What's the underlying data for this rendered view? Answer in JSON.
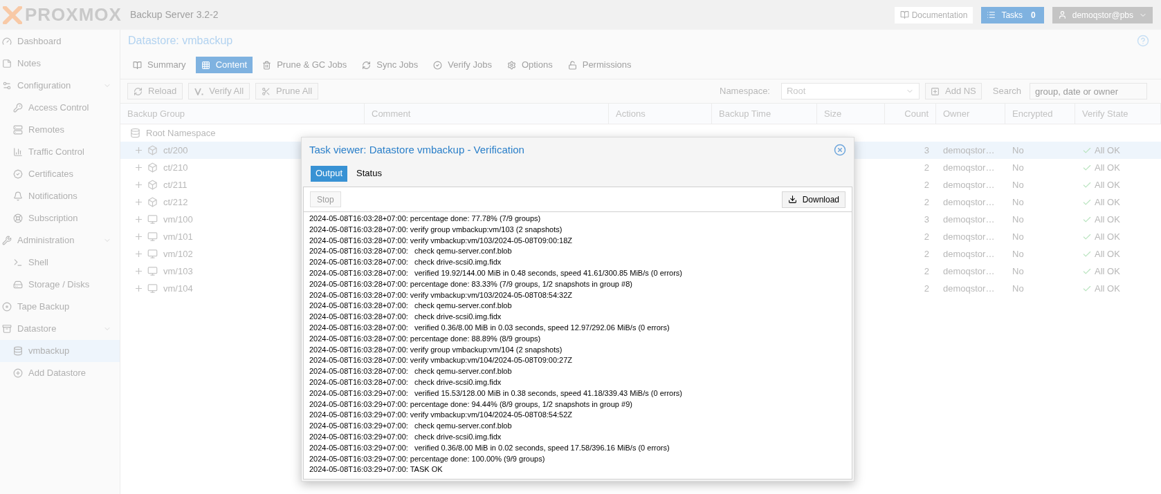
{
  "header": {
    "logo": "PROXMOX",
    "product": "Backup Server 3.2-2",
    "documentation": "Documentation",
    "tasks": {
      "label": "Tasks",
      "count": "0"
    },
    "user": "demoqstor@pbs"
  },
  "sidebar": {
    "items": [
      {
        "label": "Dashboard",
        "selected": false
      },
      {
        "label": "Notes",
        "selected": false
      },
      {
        "label": "Configuration",
        "selected": false,
        "children": [
          {
            "label": "Access Control",
            "selected": false
          },
          {
            "label": "Remotes",
            "selected": false
          },
          {
            "label": "Traffic Control",
            "selected": false
          },
          {
            "label": "Certificates",
            "selected": false
          },
          {
            "label": "Notifications",
            "selected": false
          },
          {
            "label": "Subscription",
            "selected": false
          }
        ]
      },
      {
        "label": "Administration",
        "selected": false,
        "children": [
          {
            "label": "Shell",
            "selected": false
          },
          {
            "label": "Storage / Disks",
            "selected": false
          }
        ]
      },
      {
        "label": "Tape Backup",
        "selected": false
      },
      {
        "label": "Datastore",
        "selected": false,
        "children": [
          {
            "label": "vmbackup",
            "selected": true
          },
          {
            "label": "Add Datastore",
            "selected": false
          }
        ]
      }
    ]
  },
  "content": {
    "title": "Datastore: vmbackup",
    "tabs": [
      {
        "label": "Summary",
        "selected": false
      },
      {
        "label": "Content",
        "selected": true
      },
      {
        "label": "Prune & GC Jobs",
        "selected": false
      },
      {
        "label": "Sync Jobs",
        "selected": false
      },
      {
        "label": "Verify Jobs",
        "selected": false
      },
      {
        "label": "Options",
        "selected": false
      },
      {
        "label": "Permissions",
        "selected": false
      }
    ],
    "toolbar": {
      "buttons": [
        "Reload",
        "Verify All",
        "Prune All"
      ],
      "namespace_label": "Namespace:",
      "namespace_value": "Root",
      "add_ns": "Add NS",
      "search_label": "Search",
      "search_placeholder": "group, date or owner"
    },
    "table": {
      "columns": [
        "Backup Group",
        "Comment",
        "Actions",
        "Backup Time",
        "Size",
        "Count",
        "Owner",
        "Encrypted",
        "Verify State"
      ],
      "root": "Root Namespace",
      "rows": [
        {
          "group": "ct/200",
          "kind": "container",
          "count": "3",
          "owner": "demoqstor…",
          "encrypted": "No",
          "verify": "All OK",
          "selected": true
        },
        {
          "group": "ct/210",
          "kind": "container",
          "count": "2",
          "owner": "demoqstor…",
          "encrypted": "No",
          "verify": "All OK",
          "selected": false
        },
        {
          "group": "ct/211",
          "kind": "container",
          "count": "2",
          "owner": "demoqstor…",
          "encrypted": "No",
          "verify": "All OK",
          "selected": false
        },
        {
          "group": "ct/212",
          "kind": "container",
          "count": "2",
          "owner": "demoqstor…",
          "encrypted": "No",
          "verify": "All OK",
          "selected": false
        },
        {
          "group": "vm/100",
          "kind": "vm",
          "count": "3",
          "owner": "demoqstor…",
          "encrypted": "No",
          "verify": "All OK",
          "selected": false
        },
        {
          "group": "vm/101",
          "kind": "vm",
          "count": "2",
          "owner": "demoqstor…",
          "encrypted": "No",
          "verify": "All OK",
          "selected": false
        },
        {
          "group": "vm/102",
          "kind": "vm",
          "count": "2",
          "owner": "demoqstor…",
          "encrypted": "No",
          "verify": "All OK",
          "selected": false
        },
        {
          "group": "vm/103",
          "kind": "vm",
          "count": "2",
          "owner": "demoqstor…",
          "encrypted": "No",
          "verify": "All OK",
          "selected": false
        },
        {
          "group": "vm/104",
          "kind": "vm",
          "count": "2",
          "owner": "demoqstor…",
          "encrypted": "No",
          "verify": "All OK",
          "selected": false
        }
      ]
    }
  },
  "dialog": {
    "title": "Task viewer: Datastore vmbackup - Verification",
    "tabs": [
      {
        "label": "Output",
        "selected": true
      },
      {
        "label": "Status",
        "selected": false
      }
    ],
    "stop": {
      "label": "Stop",
      "disabled": true
    },
    "download": "Download",
    "log": [
      "2024-05-08T16:03:28+07:00: percentage done: 77.78% (7/9 groups)",
      "2024-05-08T16:03:28+07:00: verify group vmbackup:vm/103 (2 snapshots)",
      "2024-05-08T16:03:28+07:00: verify vmbackup:vm/103/2024-05-08T09:00:18Z",
      "2024-05-08T16:03:28+07:00:   check qemu-server.conf.blob",
      "2024-05-08T16:03:28+07:00:   check drive-scsi0.img.fidx",
      "2024-05-08T16:03:28+07:00:   verified 19.92/144.00 MiB in 0.48 seconds, speed 41.61/300.85 MiB/s (0 errors)",
      "2024-05-08T16:03:28+07:00: percentage done: 83.33% (7/9 groups, 1/2 snapshots in group #8)",
      "2024-05-08T16:03:28+07:00: verify vmbackup:vm/103/2024-05-08T08:54:32Z",
      "2024-05-08T16:03:28+07:00:   check qemu-server.conf.blob",
      "2024-05-08T16:03:28+07:00:   check drive-scsi0.img.fidx",
      "2024-05-08T16:03:28+07:00:   verified 0.36/8.00 MiB in 0.03 seconds, speed 12.97/292.06 MiB/s (0 errors)",
      "2024-05-08T16:03:28+07:00: percentage done: 88.89% (8/9 groups)",
      "2024-05-08T16:03:28+07:00: verify group vmbackup:vm/104 (2 snapshots)",
      "2024-05-08T16:03:28+07:00: verify vmbackup:vm/104/2024-05-08T09:00:27Z",
      "2024-05-08T16:03:28+07:00:   check qemu-server.conf.blob",
      "2024-05-08T16:03:28+07:00:   check drive-scsi0.img.fidx",
      "2024-05-08T16:03:29+07:00:   verified 15.53/128.00 MiB in 0.38 seconds, speed 41.18/339.43 MiB/s (0 errors)",
      "2024-05-08T16:03:29+07:00: percentage done: 94.44% (8/9 groups, 1/2 snapshots in group #9)",
      "2024-05-08T16:03:29+07:00: verify vmbackup:vm/104/2024-05-08T08:54:52Z",
      "2024-05-08T16:03:29+07:00:   check qemu-server.conf.blob",
      "2024-05-08T16:03:29+07:00:   check drive-scsi0.img.fidx",
      "2024-05-08T16:03:29+07:00:   verified 0.36/8.00 MiB in 0.02 seconds, speed 17.58/396.16 MiB/s (0 errors)",
      "2024-05-08T16:03:29+07:00: percentage done: 100.00% (9/9 groups)",
      "2024-05-08T16:03:29+07:00: TASK OK"
    ]
  }
}
